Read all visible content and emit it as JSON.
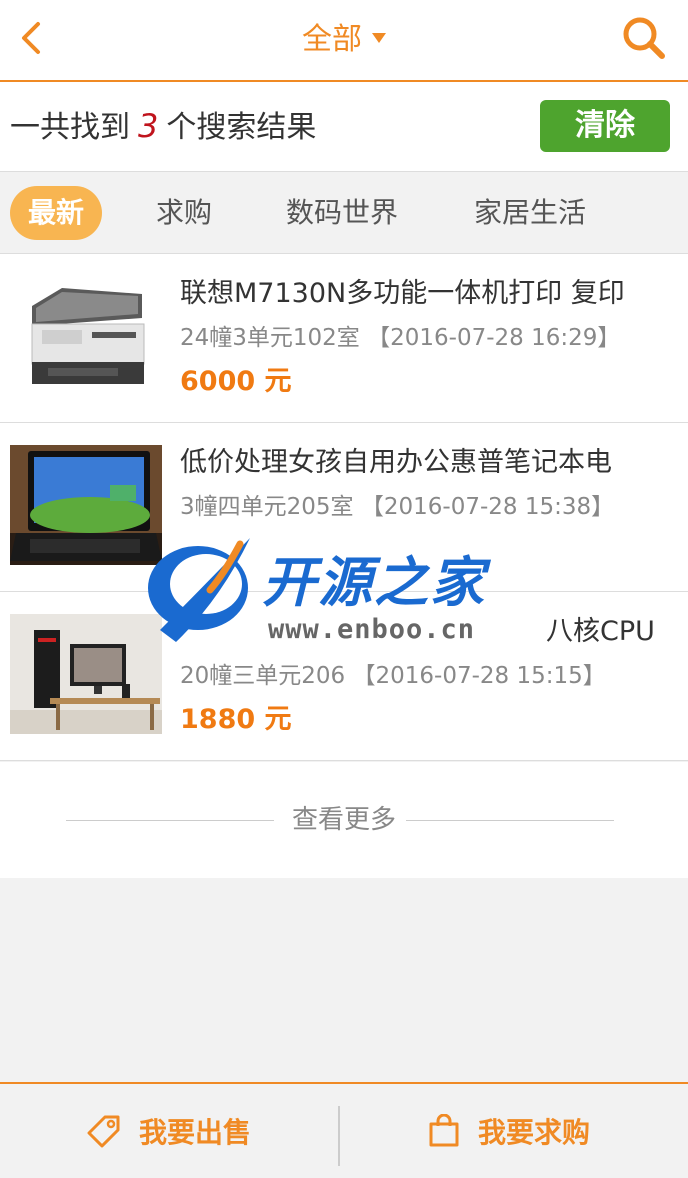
{
  "header": {
    "title": "全部",
    "back_icon": "chevron-left-icon",
    "search_icon": "search-icon"
  },
  "result_bar": {
    "prefix": "一共找到",
    "count": "3",
    "suffix": "个搜索结果",
    "clear_label": "清除"
  },
  "tabs": [
    {
      "label": "最新",
      "active": true
    },
    {
      "label": "求购",
      "active": false
    },
    {
      "label": "数码世界",
      "active": false
    },
    {
      "label": "家居生活",
      "active": false
    }
  ],
  "items": [
    {
      "title": "联想M7130N多功能一体机打印 复印",
      "location": "24幢3单元102室",
      "time": "【2016-07-28 16:29】",
      "price": "6000 元"
    },
    {
      "title": "低价处理女孩自用办公惠普笔记本电",
      "location": "3幢四单元205室",
      "time": "【2016-07-28 15:38】",
      "price": ""
    },
    {
      "title": "八核CPU",
      "location": "20幢三单元206",
      "time": "【2016-07-28 15:15】",
      "price": "1880 元"
    }
  ],
  "more_label": "查看更多",
  "bottom_bar": {
    "sell_label": "我要出售",
    "buy_label": "我要求购"
  },
  "watermark": {
    "name": "开源之家",
    "url": "www.enboo.cn"
  },
  "colors": {
    "accent": "#f08a24",
    "clear_button": "#4ea42e",
    "price": "#f07a12",
    "count": "#c0141d",
    "active_tab": "#f8b551"
  }
}
